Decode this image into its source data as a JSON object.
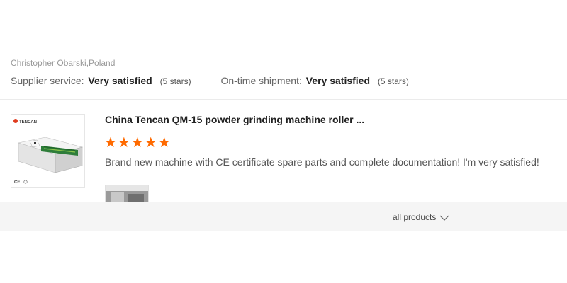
{
  "review": {
    "reviewer": "Christopher Obarski,Poland",
    "ratings": [
      {
        "label": "Supplier service:",
        "value": "Very satisfied",
        "stars": "(5 stars)"
      },
      {
        "label": "On-time shipment:",
        "value": "Very satisfied",
        "stars": "(5 stars)"
      }
    ],
    "product": {
      "title": "China Tencan QM-15 powder grinding machine roller ...",
      "brand_logo_text": "TENCAN",
      "cert_mark": "CE",
      "rating": 5,
      "stars_text": "★★★★★",
      "comment": "Brand new machine with CE certificate spare parts and complete documentation! I'm very satisfied!"
    }
  },
  "footer": {
    "all_products_label": "all products",
    "icon": "chevron-down-icon"
  },
  "colors": {
    "accent": "#ff6a00",
    "footer_bg": "#f5f5f5",
    "divider": "#ebebeb"
  }
}
